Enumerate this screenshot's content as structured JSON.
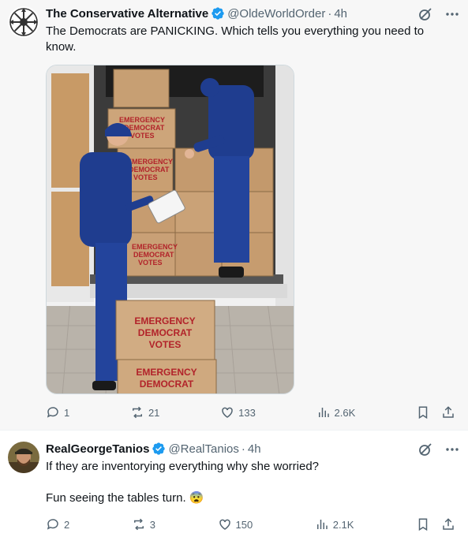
{
  "tweets": [
    {
      "author": "The Conservative Alternative",
      "handle": "@OldeWorldOrder",
      "time": "4h",
      "text": "The Democrats are PANICKING. Which tells you everything you need to know.",
      "media": {
        "box_labels": [
          "EMERGENCY",
          "DEMOCRAT",
          "VOTES"
        ],
        "top_box_labels": [
          "EMERGENCY",
          "DEMOCRAT",
          "VOTES"
        ]
      },
      "stats": {
        "replies": "1",
        "reposts": "21",
        "likes": "133",
        "views": "2.6K"
      }
    },
    {
      "author": "RealGeorgeTanios",
      "handle": "@RealTanios",
      "time": "4h",
      "text_line1": "If they are inventorying everything why she worried?",
      "text_line2": "Fun seeing the tables turn.",
      "emoji": "😨",
      "stats": {
        "replies": "2",
        "reposts": "3",
        "likes": "150",
        "views": "2.1K"
      }
    }
  ],
  "colors": {
    "verified": "#1d9bf0",
    "muted": "#536471",
    "text": "#0f1419",
    "workwear": "#1f3d8f",
    "box": "#c9a074"
  },
  "icons": [
    "grok-icon",
    "more-icon",
    "reply-icon",
    "repost-icon",
    "like-icon",
    "views-icon",
    "bookmark-icon",
    "share-icon",
    "verified-badge-icon"
  ]
}
